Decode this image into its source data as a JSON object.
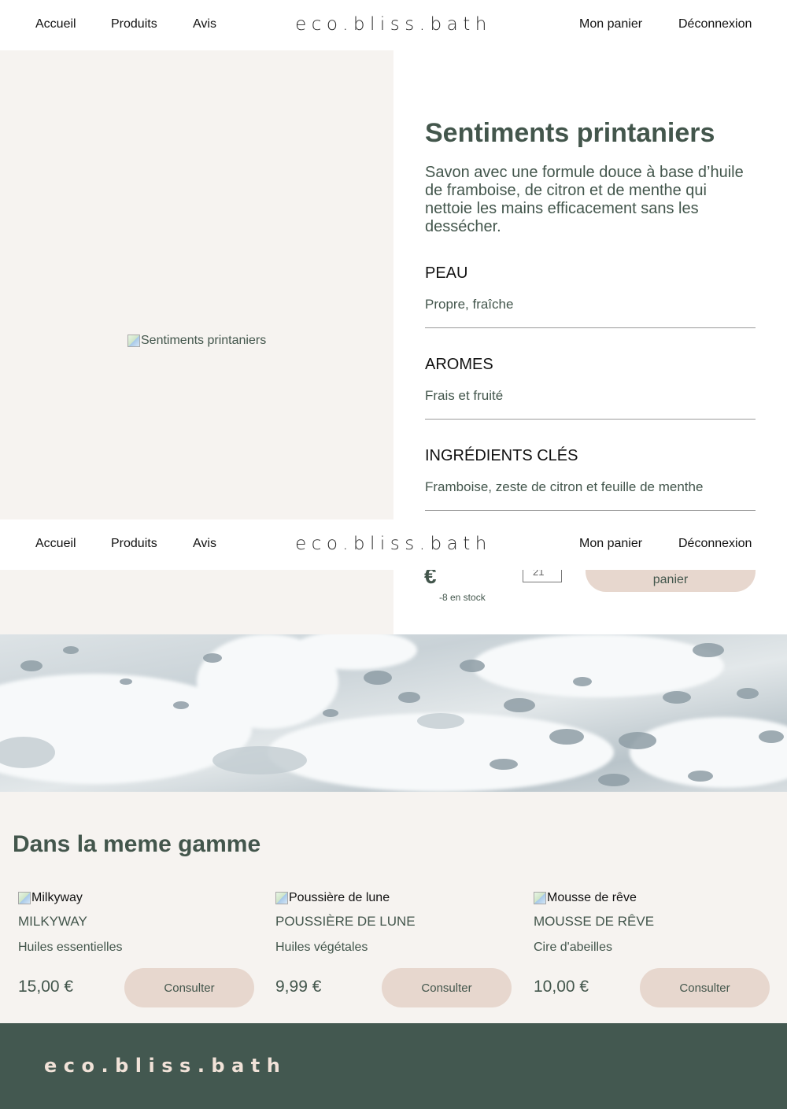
{
  "nav": {
    "home": "Accueil",
    "products": "Produits",
    "reviews": "Avis",
    "brand": "eco.bliss.bath",
    "cart": "Mon panier",
    "logout": "Déconnexion"
  },
  "product": {
    "image_alt": "Sentiments printaniers",
    "title": "Sentiments printaniers",
    "description": "Savon avec une formule douce à base d’huile de framboise, de citron et de menthe qui nettoie les mains efficacement sans les dessécher.",
    "sections": [
      {
        "heading": "PEAU",
        "value": "Propre, fraîche"
      },
      {
        "heading": "AROMES",
        "value": "Frais et fruité"
      },
      {
        "heading": "INGRÉDIENTS CLÉS",
        "value": "Framboise, zeste de citron et feuille de menthe"
      }
    ],
    "currency": "€",
    "stock": "-8 en stock",
    "quantity": "21",
    "add_button": "panier"
  },
  "range": {
    "title": "Dans la meme gamme",
    "items": [
      {
        "image_alt": "Milkyway",
        "name": "Milkyway",
        "type": "Huiles essentielles",
        "price": "15,00 €",
        "button": "Consulter"
      },
      {
        "image_alt": "Poussière de lune",
        "name": "Poussière de lune",
        "type": "Huiles végétales",
        "price": "9,99 €",
        "button": "Consulter"
      },
      {
        "image_alt": "Mousse de rêve",
        "name": "Mousse de rêve",
        "type": "Cire d'abeilles",
        "price": "10,00 €",
        "button": "Consulter"
      }
    ]
  },
  "footer": {
    "brand": "eco.bliss.bath"
  },
  "colors": {
    "primary": "#43564c",
    "accent": "#e7d7ce",
    "panel_bg": "#f6f3f0",
    "footer_bg": "#435850",
    "footer_text": "#f1e2d8"
  }
}
